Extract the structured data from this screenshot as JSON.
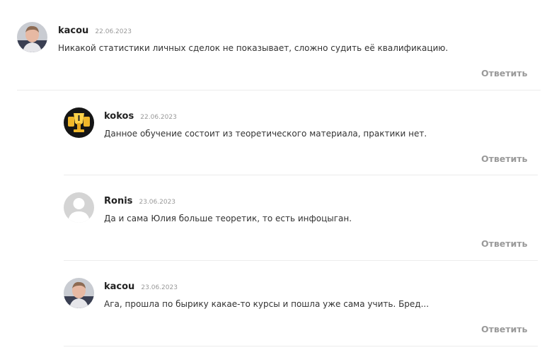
{
  "comments": [
    {
      "author": "kacou",
      "date": "22.06.2023",
      "text": "Никакой статистики личных сделок не показывает, сложно судить её квалификацию.",
      "reply_label": "Ответить",
      "avatar": "person-photo-icon"
    },
    {
      "author": "kokos",
      "date": "22.06.2023",
      "text": "Данное обучение состоит из теоретического материала, практики нет.",
      "reply_label": "Ответить",
      "avatar": "trophy-icon"
    },
    {
      "author": "Ronis",
      "date": "23.06.2023",
      "text": "Да и сама Юлия больше теоретик, то есть инфоцыган.",
      "reply_label": "Ответить",
      "avatar": "default-user-icon"
    },
    {
      "author": "kacou",
      "date": "23.06.2023",
      "text": "Ага, прошла по бырику какае-то курсы и пошла уже сама учить. Бред...",
      "reply_label": "Ответить",
      "avatar": "person-photo-icon"
    }
  ],
  "colors": {
    "author": "#222222",
    "date": "#999999",
    "reply": "#9a9a9a",
    "divider": "#ececec"
  }
}
